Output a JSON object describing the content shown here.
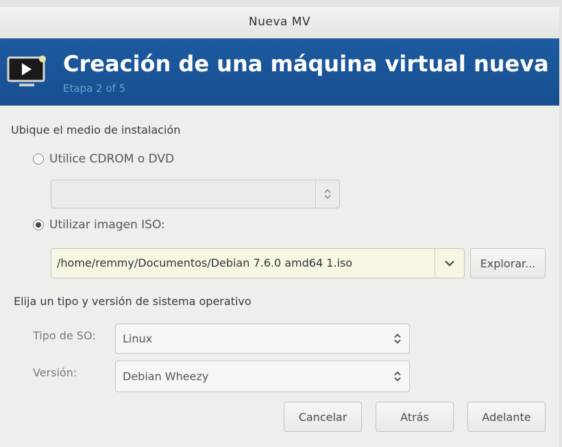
{
  "window": {
    "title": "Nueva MV"
  },
  "banner": {
    "heading": "Creación de una máquina virtual nueva",
    "step": "Etapa 2 of 5",
    "icon": "monitor-play-icon"
  },
  "install_media": {
    "section_label": "Ubique el medio de instalación",
    "cdrom_option": {
      "label": "Utilice CDROM o DVD",
      "selected": false
    },
    "cdrom_select": {
      "value": ""
    },
    "iso_option": {
      "label": "Utilizar imagen ISO:",
      "selected": true
    },
    "iso_path": "/home/remmy/Documentos/Debian 7.6.0 amd64 1.iso",
    "browse_label": "Explorar..."
  },
  "os_section": {
    "section_label": "Elija un tipo y versión de sistema operativo",
    "os_type_label": "Tipo de SO:",
    "os_type_value": "Linux",
    "version_label": "Versión:",
    "version_value": "Debian Wheezy"
  },
  "footer": {
    "cancel_label": "Cancelar",
    "back_label": "Atrás",
    "forward_label": "Adelante"
  },
  "colors": {
    "banner": "#1d5aa0",
    "iso_field_bg": "#f7f5e4"
  }
}
